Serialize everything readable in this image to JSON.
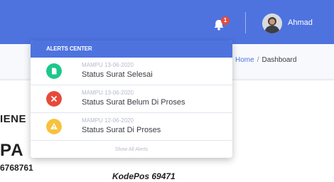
{
  "topbar": {
    "alert_count": "1",
    "username": "Ahmad",
    "colors": {
      "bar": "#4e73df",
      "badge": "#e74a3b"
    }
  },
  "breadcrumb": {
    "home": "Home",
    "separator": "/",
    "current": "Dashboard"
  },
  "background_doc": {
    "line1": "IENE",
    "line2": "PA",
    "line3": "6768761",
    "line4": "KodePos 69471"
  },
  "alerts": {
    "header": "ALERTS CENTER",
    "items": [
      {
        "date": "MAMPU 13-06-2020",
        "text": "Status Surat Selesai",
        "icon": "file-icon",
        "color": "#1cc88a"
      },
      {
        "date": "MAMPU 13-06-2020",
        "text": "Status Surat Belum Di Proses",
        "icon": "close-icon",
        "color": "#e74a3b"
      },
      {
        "date": "MAMPU 12-06-2020",
        "text": "Status Surat Di Proses",
        "icon": "warning-icon",
        "color": "#f6c23e"
      }
    ],
    "footer": "Show All Alerts"
  }
}
